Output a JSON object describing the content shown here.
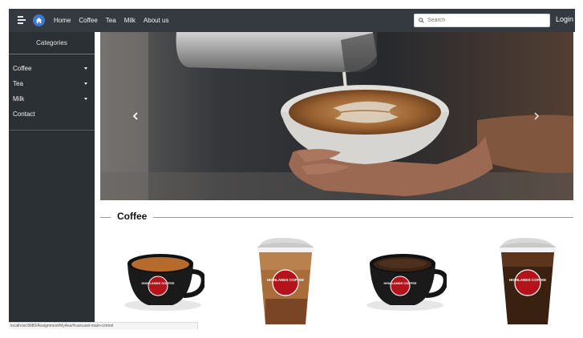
{
  "nav": {
    "links": [
      "Home",
      "Coffee",
      "Tea",
      "Milk",
      "About us"
    ],
    "search_placeholder": "Search",
    "login_label": "Login"
  },
  "sidebar": {
    "title": "Categories",
    "items": [
      {
        "label": "Coffee",
        "has_dropdown": true
      },
      {
        "label": "Tea",
        "has_dropdown": true
      },
      {
        "label": "Milk",
        "has_dropdown": true
      },
      {
        "label": "Contact",
        "has_dropdown": false
      }
    ]
  },
  "carousel": {
    "image": "latte-art-pour",
    "prev_icon": "chevron-left-icon",
    "next_icon": "chevron-right-icon"
  },
  "section": {
    "title": "Coffee"
  },
  "products": [
    {
      "image": "hot-coffee-cup-mug",
      "brand": "HIGHLANDS COFFEE"
    },
    {
      "image": "iced-milk-coffee-cup",
      "brand": "HIGHLANDS COFFEE"
    },
    {
      "image": "hot-black-coffee-mug",
      "brand": "HIGHLANDS COFFEE"
    },
    {
      "image": "iced-black-coffee-cup",
      "brand": "HIGHLANDS COFFEE"
    }
  ],
  "status_bar": {
    "url": "localhost:8080/Assignment/MyAss/#carousel-main-control"
  },
  "colors": {
    "navbar": "#343a40",
    "sidebar": "#2b3035",
    "home_icon": "#3a78d6",
    "brand_red": "#b5121b"
  }
}
